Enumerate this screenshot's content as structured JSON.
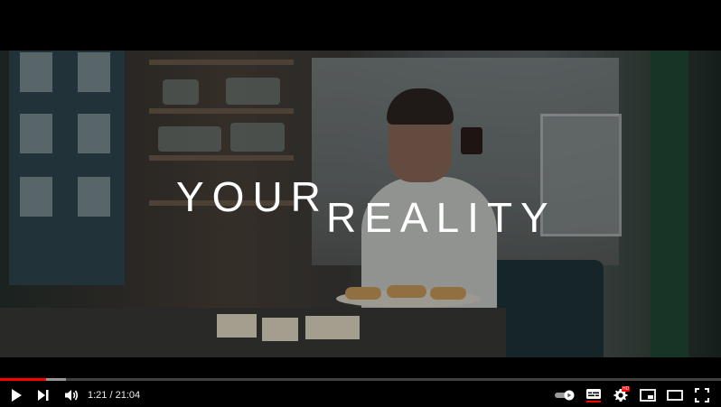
{
  "video": {
    "title_line1": "YOUR",
    "title_line2": "REALITY"
  },
  "player": {
    "current_time": "1:21",
    "duration": "21:04",
    "time_display": "1:21 / 21:04",
    "played_fraction": 0.064,
    "loaded_fraction": 0.092,
    "accent_color": "#ff0000",
    "settings_badge": "HD"
  },
  "controls": {
    "play_icon": "play-icon",
    "next_icon": "next-icon",
    "volume_icon": "volume-icon",
    "autoplay_icon": "autoplay-toggle-icon",
    "captions_icon": "captions-icon",
    "settings_icon": "gear-icon",
    "miniplayer_icon": "miniplayer-icon",
    "theater_icon": "theater-icon",
    "fullscreen_icon": "fullscreen-icon"
  }
}
